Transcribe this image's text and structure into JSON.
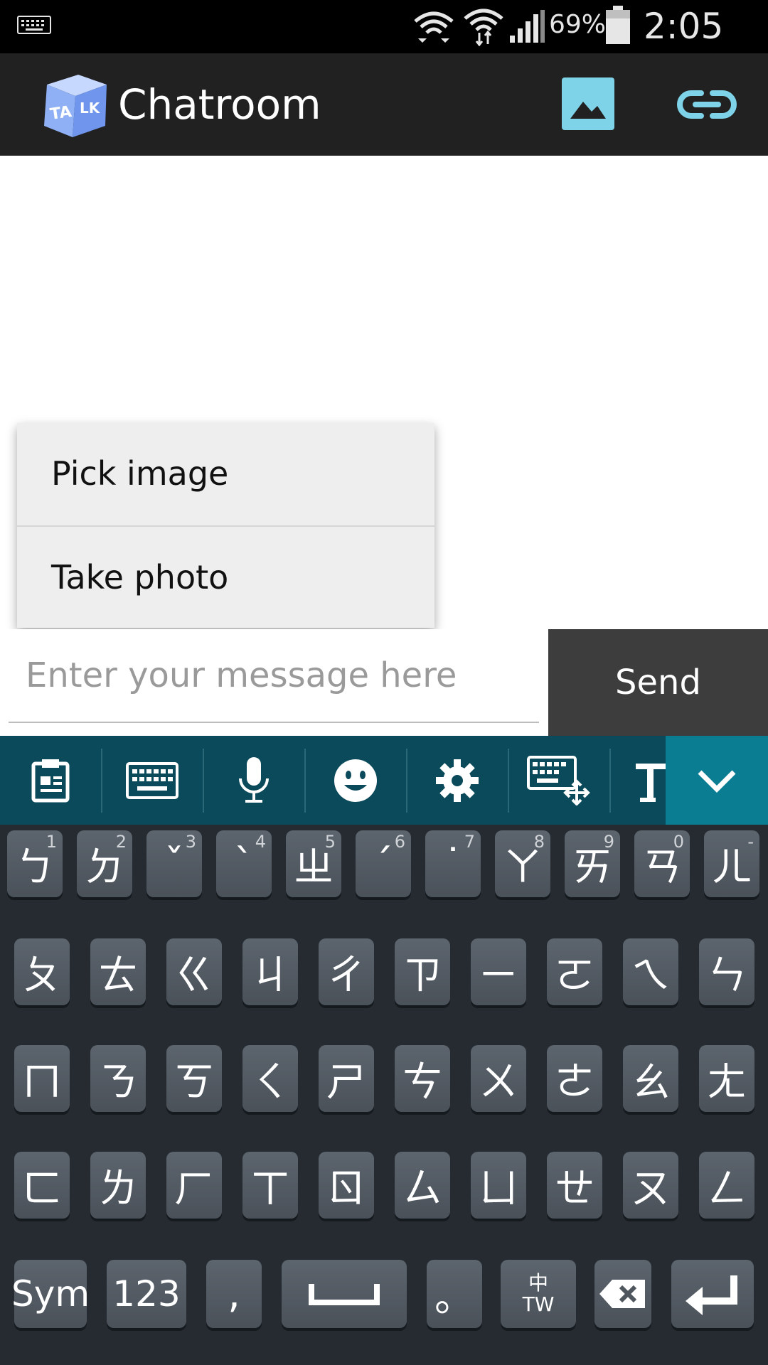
{
  "status_bar": {
    "battery_percent": "69%",
    "time": "2:05 PM",
    "icons": [
      "keyboard-icon",
      "wifi-icon",
      "wifi-transfer-icon",
      "signal-icon",
      "battery-icon"
    ]
  },
  "app_bar": {
    "title": "Chatroom",
    "logo_text": "TALK",
    "actions": [
      "image-icon",
      "link-icon"
    ]
  },
  "popup_menu": {
    "items": [
      "Pick image",
      "Take photo"
    ]
  },
  "composer": {
    "placeholder": "Enter your message here",
    "value": "",
    "send_label": "Send"
  },
  "keyboard_toolbar": {
    "tools": [
      "clipboard-icon",
      "keyboard-icon",
      "microphone-icon",
      "emoji-icon",
      "settings-icon",
      "keyboard-resize-icon",
      "text-format-icon"
    ],
    "collapse": "chevron-down-icon"
  },
  "keyboard": {
    "row1": [
      {
        "key": "ㄅ",
        "hint": "1"
      },
      {
        "key": "ㄉ",
        "hint": "2"
      },
      {
        "key": "ˇ",
        "hint": "3"
      },
      {
        "key": "ˋ",
        "hint": "4"
      },
      {
        "key": "ㄓ",
        "hint": "5"
      },
      {
        "key": "ˊ",
        "hint": "6"
      },
      {
        "key": "˙",
        "hint": "7"
      },
      {
        "key": "ㄚ",
        "hint": "8"
      },
      {
        "key": "ㄞ",
        "hint": "9"
      },
      {
        "key": "ㄢ",
        "hint": "0"
      },
      {
        "key": "ㄦ",
        "hint": "-"
      }
    ],
    "row2": [
      "ㄆ",
      "ㄊ",
      "ㄍ",
      "ㄐ",
      "ㄔ",
      "ㄗ",
      "ㄧ",
      "ㄛ",
      "ㄟ",
      "ㄣ"
    ],
    "row3": [
      "ㄇ",
      "ㄋ",
      "ㄎ",
      "ㄑ",
      "ㄕ",
      "ㄘ",
      "ㄨ",
      "ㄜ",
      "ㄠ",
      "ㄤ"
    ],
    "row4": [
      "ㄈ",
      "ㄌ",
      "ㄏ",
      "ㄒ",
      "ㄖ",
      "ㄙ",
      "ㄩ",
      "ㄝ",
      "ㄡ",
      "ㄥ"
    ],
    "bottom": {
      "sym": "Sym",
      "num": "123",
      "comma": ",",
      "period": "。",
      "lang_top": "中",
      "lang_bottom": "TW"
    }
  }
}
